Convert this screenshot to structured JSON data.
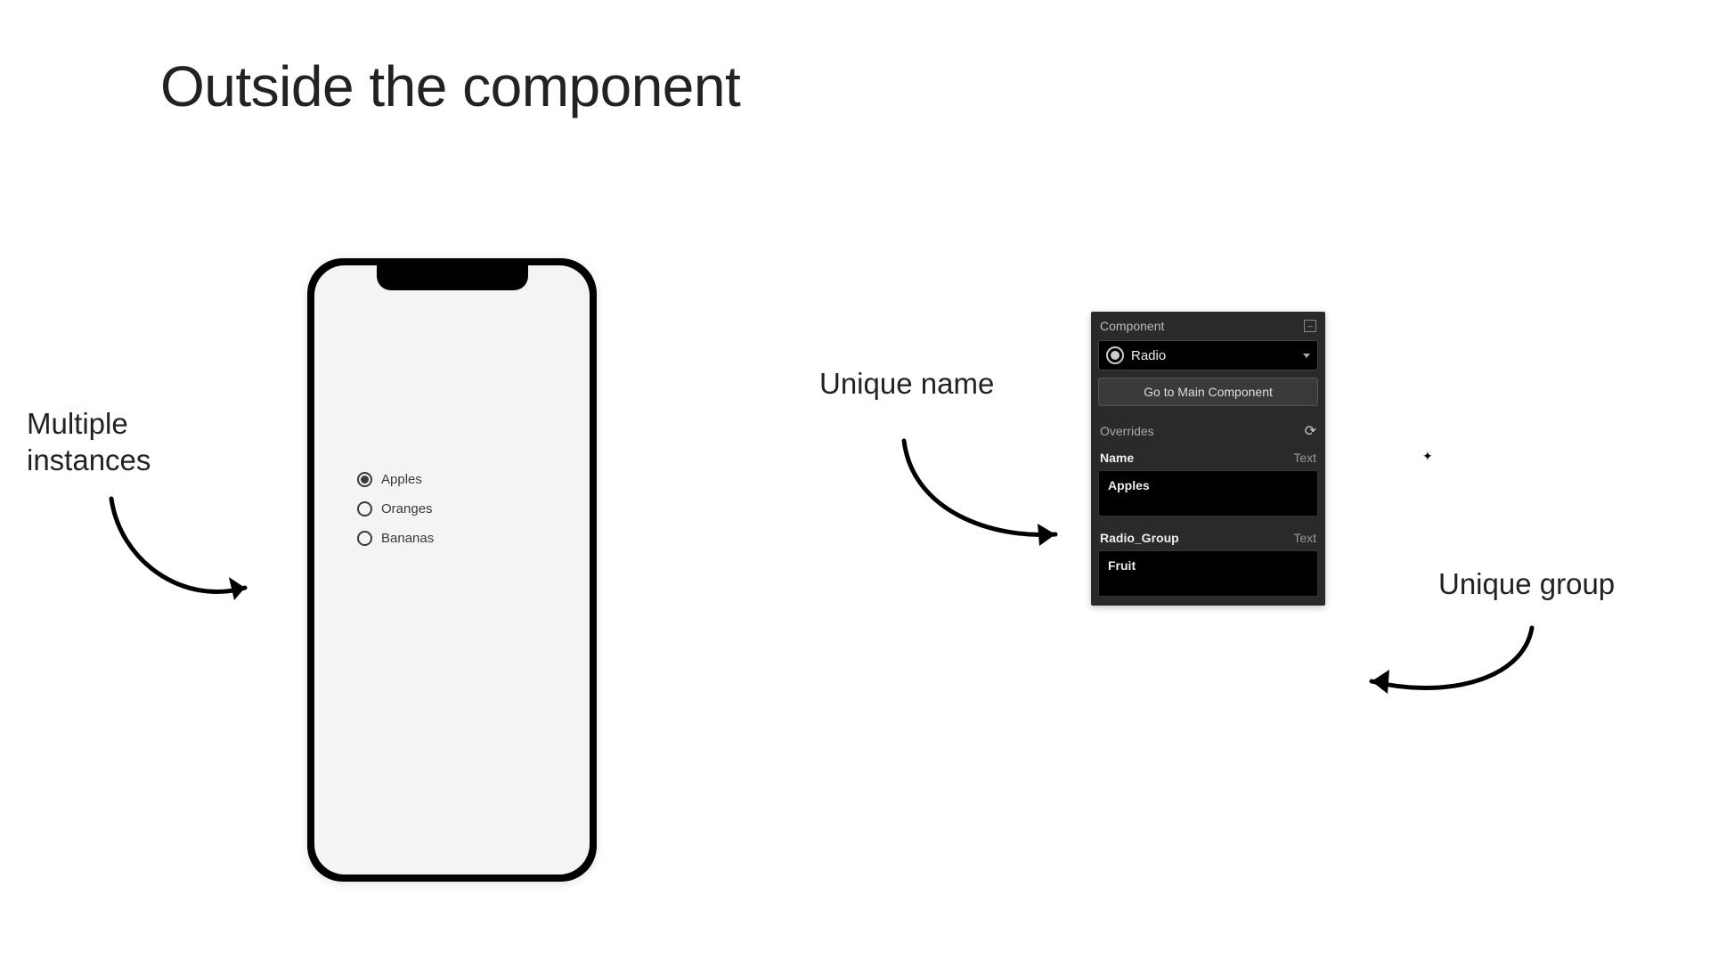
{
  "slide": {
    "title": "Outside the component"
  },
  "phone": {
    "radios": [
      {
        "label": "Apples",
        "selected": true
      },
      {
        "label": "Oranges",
        "selected": false
      },
      {
        "label": "Bananas",
        "selected": false
      }
    ]
  },
  "panel": {
    "header": "Component",
    "component_name": "Radio",
    "goto_button": "Go to Main Component",
    "overrides_label": "Overrides",
    "fields": [
      {
        "label": "Name",
        "type": "Text",
        "value": "Apples"
      },
      {
        "label": "Radio_Group",
        "type": "Text",
        "value": "Fruit"
      }
    ]
  },
  "annotations": {
    "multiple_instances_line1": "Multiple",
    "multiple_instances_line2": "instances",
    "unique_name": "Unique name",
    "unique_group": "Unique group"
  }
}
